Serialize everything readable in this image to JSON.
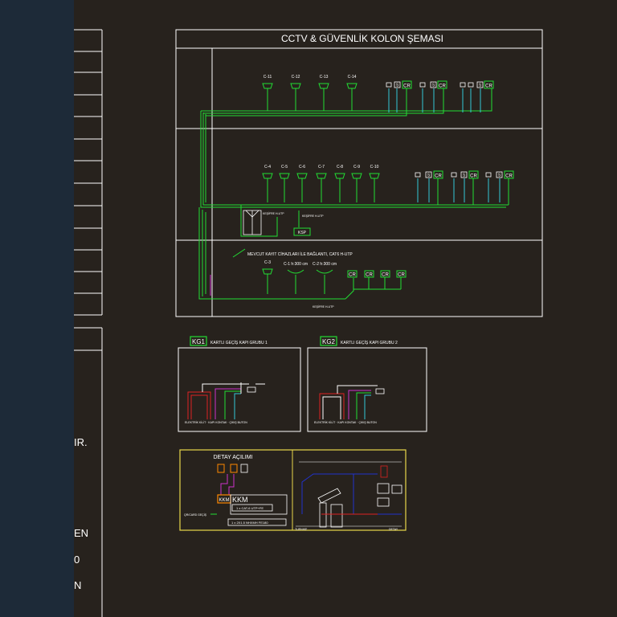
{
  "colors": {
    "background": "#27221d",
    "sidebar": "#1d2a38",
    "frame": "#ffffff",
    "green": "#22dd33",
    "cyan": "#33c8d8",
    "magenta": "#cc33cc",
    "red": "#dd2222",
    "yellow": "#e8d84a",
    "orange": "#ff8800",
    "blue": "#2233cc"
  },
  "main": {
    "title": "CCTV & GÜVENLİK KOLON ŞEMASI",
    "floor1_cameras": [
      "C-11",
      "C-12",
      "C-13",
      "C-14"
    ],
    "floor2_cameras": [
      "C-4",
      "C-5",
      "C-6",
      "C-7",
      "C-8",
      "C-9",
      "C-10"
    ],
    "cr": "CR",
    "sensor_mark": "S",
    "small_label_1": "KEŞİFRE H-UTP",
    "small_label_2": "KEŞİFRE H-UTP",
    "ksp": "KSP",
    "mevcut_note": "MEVCUT KAYIT CİHAZLARI İLE BAĞLANTI, CAT6 H-UTP",
    "c3": "C-3",
    "c1": "C-1 h:300 cm",
    "c2": "C-2 h:300 cm",
    "bottom_cable": "KEŞİFRE H-UTP"
  },
  "kg1": {
    "badge": "KG1",
    "title": "KARTLI GEÇİŞ KAPI GRUBU 1",
    "footer": "ELEKTRİK KİLİT · KAPI KONTAK · ÇIKIŞ BUTON"
  },
  "kg2": {
    "badge": "KG2",
    "title": "KARTLI GEÇİŞ KAPI GRUBU 2",
    "footer": "ELEKTRİK KİLİT · KAPI KONTAK · ÇIKIŞ BUTON"
  },
  "detail": {
    "title": "DETAY AÇILIMI",
    "kkm": "KKM",
    "kkm_small": "KKM",
    "line1": "1 x CAT-6 UTP+FE",
    "line2": "1 x 2X1.5 NHXMH FE180",
    "qr": "QR/CARD GEÇİŞ",
    "left_caption": "TURNIKE",
    "right_caption": "DETAY"
  },
  "sidebar_text": {
    "t1": "IR.",
    "t2": "EN",
    "t3": "0",
    "t4": "N"
  }
}
